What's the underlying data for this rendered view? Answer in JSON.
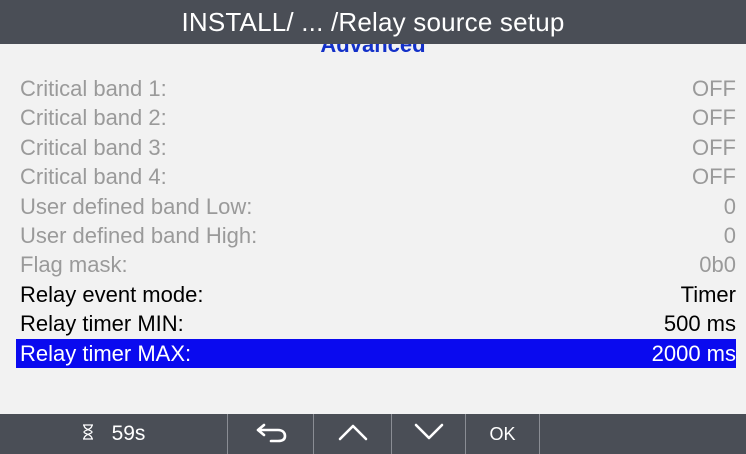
{
  "title": "INSTALL/ ... /Relay source setup",
  "section_header": "Advanced",
  "rows": [
    {
      "label": "Critical band 1:",
      "value": "OFF",
      "state": "disabled"
    },
    {
      "label": "Critical band 2:",
      "value": "OFF",
      "state": "disabled"
    },
    {
      "label": "Critical band 3:",
      "value": "OFF",
      "state": "disabled"
    },
    {
      "label": "Critical band 4:",
      "value": "OFF",
      "state": "disabled"
    },
    {
      "label": "User defined band Low:",
      "value": "0",
      "state": "disabled"
    },
    {
      "label": "User defined band High:",
      "value": "0",
      "state": "disabled"
    },
    {
      "label": "Flag mask:",
      "value": "0b0",
      "state": "disabled"
    },
    {
      "label": "Relay event mode:",
      "value": "Timer",
      "state": "enabled"
    },
    {
      "label": "Relay timer MIN:",
      "value": "500 ms",
      "state": "enabled"
    },
    {
      "label": "Relay timer MAX:",
      "value": "2000 ms",
      "state": "selected"
    }
  ],
  "toolbar": {
    "timer_icon": "hourglass-icon",
    "timer_text": "59s",
    "back_icon": "back-arrow-icon",
    "up_icon": "chevron-up-icon",
    "down_icon": "chevron-down-icon",
    "ok_label": "OK"
  },
  "colors": {
    "titlebar_bg": "#4a4e56",
    "selection_bg": "#0a0aef",
    "section_header": "#1330c8",
    "disabled_text": "#9a9a9a"
  }
}
